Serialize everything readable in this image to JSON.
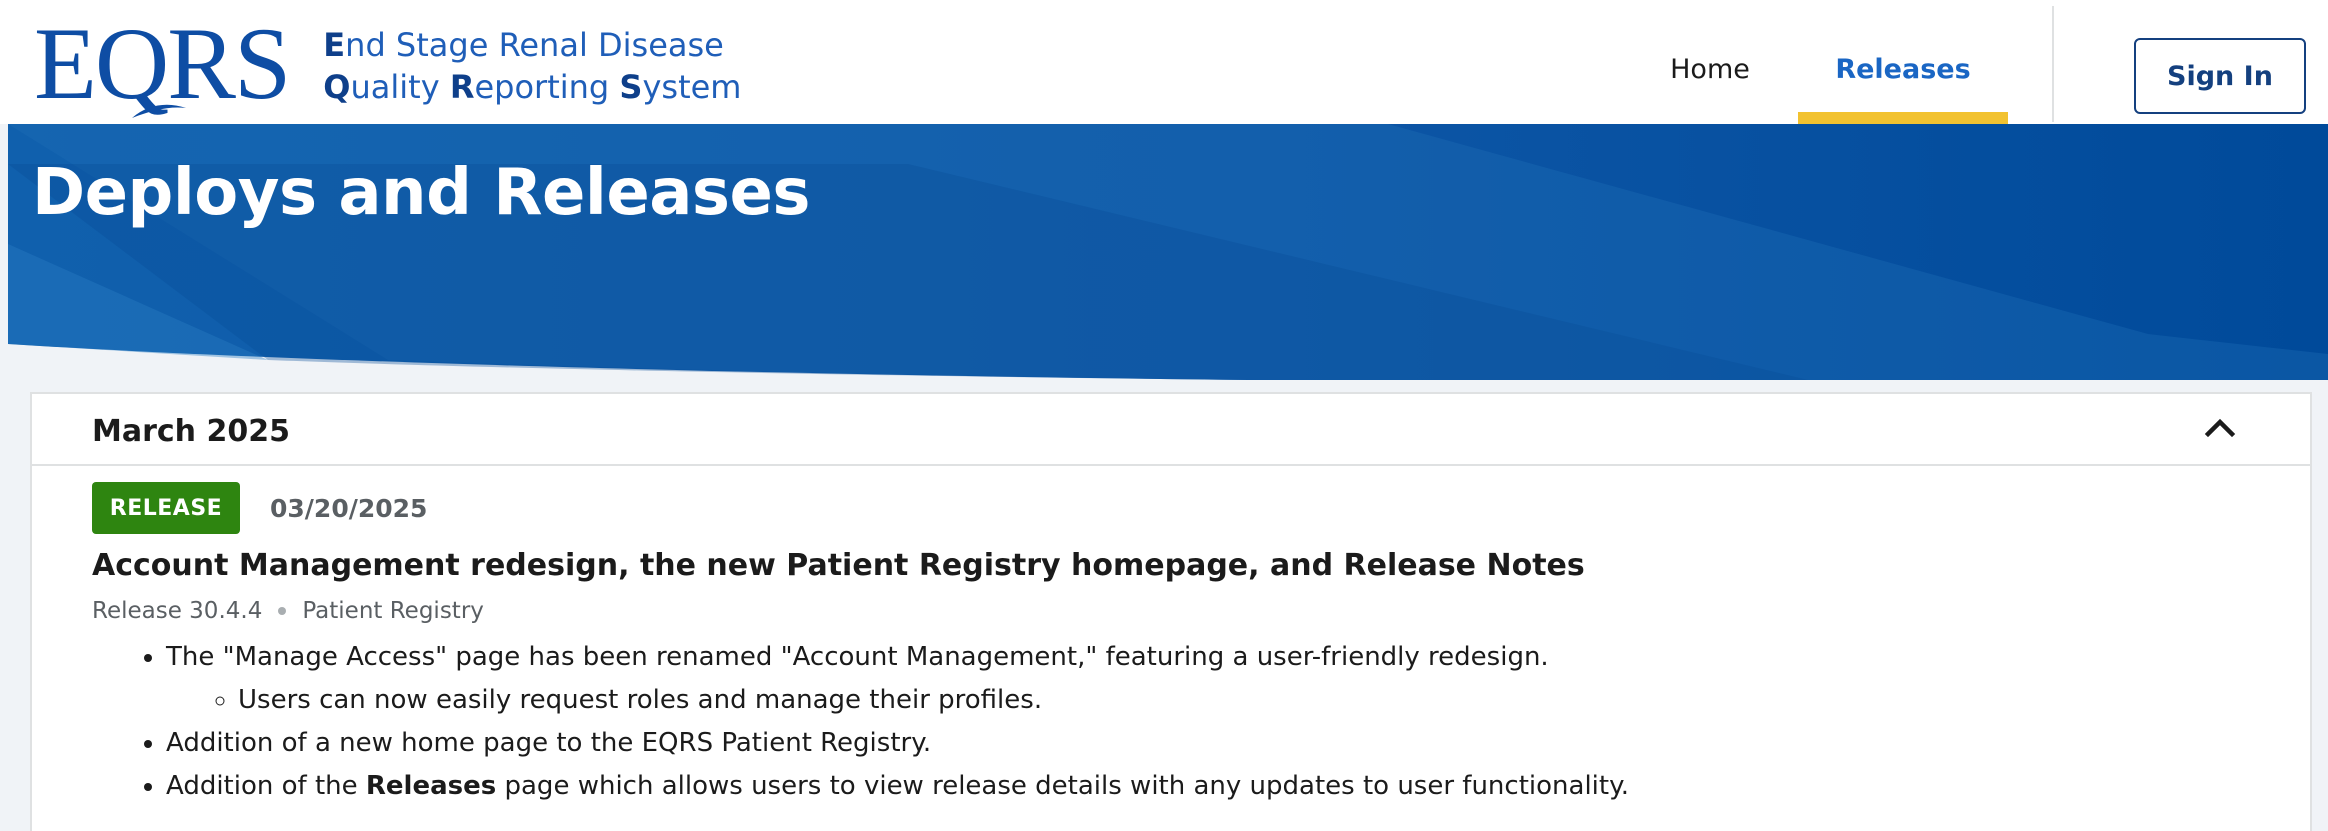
{
  "header": {
    "logo_mark": "EQRS",
    "logo_line1_initial": "E",
    "logo_line1_rest": "nd Stage Renal Disease",
    "logo_line2_q": "Q",
    "logo_line2_uality": "uality ",
    "logo_line2_r": "R",
    "logo_line2_eporting": "eporting ",
    "logo_line2_s": "S",
    "logo_line2_ystem": "ystem",
    "nav": {
      "home": "Home",
      "releases": "Releases"
    },
    "sign_in": "Sign In"
  },
  "hero": {
    "title": "Deploys and Releases"
  },
  "accordion": {
    "title": "March 2025",
    "expanded": true,
    "entry": {
      "tag": "RELEASE",
      "tag_color": "#2e8510",
      "date": "03/20/2025",
      "title": "Account Management redesign, the new Patient Registry homepage, and Release Notes",
      "release": "Release 30.4.4",
      "module": "Patient Registry",
      "bullet1": "The \"Manage Access\" page has been renamed \"Account Management,\" featuring a user-friendly redesign.",
      "bullet1_sub": "Users can now easily request roles and manage their profiles.",
      "bullet2": "Addition of a new home page to the EQRS Patient Registry.",
      "bullet3_prefix": "Addition of the ",
      "bullet3_bold": "Releases",
      "bullet3_suffix": " page which allows users to view release details with any updates to user functionality."
    }
  },
  "colors": {
    "brand_blue": "#0e4da4",
    "active_nav": "#1a66c4",
    "active_underline": "#f2c230",
    "hero_blue": "#0d56a6"
  }
}
